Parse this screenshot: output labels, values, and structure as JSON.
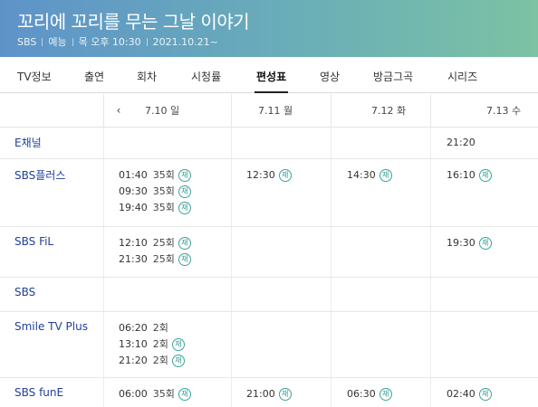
{
  "program": {
    "title": "꼬리에 꼬리를 무는 그날 이야기",
    "meta": [
      "SBS",
      "예능",
      "목 오후 10:30",
      "2021.10.21~"
    ]
  },
  "tabs": [
    "TV정보",
    "출연",
    "회차",
    "시청률",
    "편성표",
    "영상",
    "방금그곡",
    "시리즈"
  ],
  "active_tab": "편성표",
  "schedule": {
    "prev_icon": "chevron-left-icon",
    "prev_label": "‹",
    "dates": [
      "7.10 일",
      "7.11 월",
      "7.12 화",
      "7.13 수"
    ],
    "rerun_label": "재",
    "channels": [
      {
        "name": "E채널",
        "days": [
          [],
          [],
          [],
          [
            {
              "time": "21:20"
            }
          ]
        ]
      },
      {
        "name": "SBS플러스",
        "days": [
          [
            {
              "time": "01:40",
              "ep": "35회",
              "rerun": true
            },
            {
              "time": "09:30",
              "ep": "35회",
              "rerun": true
            },
            {
              "time": "19:40",
              "ep": "35회",
              "rerun": true
            }
          ],
          [
            {
              "time": "12:30",
              "rerun": true
            }
          ],
          [
            {
              "time": "14:30",
              "rerun": true
            }
          ],
          [
            {
              "time": "16:10",
              "rerun": true
            }
          ]
        ]
      },
      {
        "name": "SBS FiL",
        "days": [
          [
            {
              "time": "12:10",
              "ep": "25회",
              "rerun": true
            },
            {
              "time": "21:30",
              "ep": "25회",
              "rerun": true
            }
          ],
          [],
          [],
          [
            {
              "time": "19:30",
              "rerun": true
            }
          ]
        ]
      },
      {
        "name": "SBS",
        "days": [
          [],
          [],
          [],
          []
        ]
      },
      {
        "name": "Smile TV Plus",
        "days": [
          [
            {
              "time": "06:20",
              "ep": "2회"
            },
            {
              "time": "13:10",
              "ep": "2회",
              "rerun": true
            },
            {
              "time": "21:20",
              "ep": "2회",
              "rerun": true
            }
          ],
          [],
          [],
          []
        ]
      },
      {
        "name": "SBS funE",
        "days": [
          [
            {
              "time": "06:00",
              "ep": "35회",
              "rerun": true
            }
          ],
          [
            {
              "time": "21:00",
              "rerun": true
            }
          ],
          [
            {
              "time": "06:30",
              "rerun": true
            }
          ],
          [
            {
              "time": "02:40",
              "rerun": true
            }
          ]
        ]
      }
    ]
  }
}
